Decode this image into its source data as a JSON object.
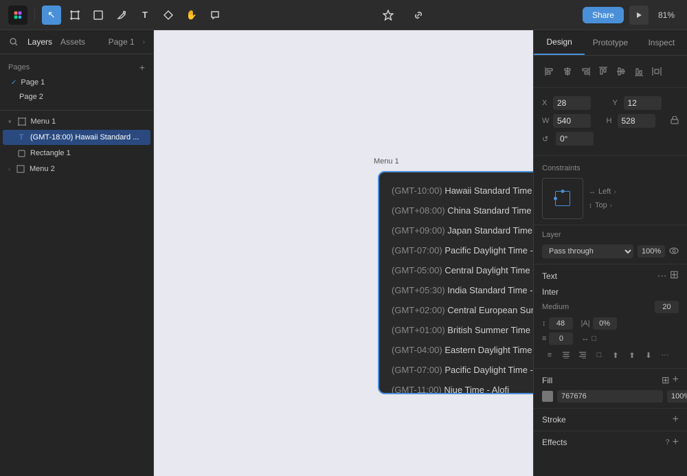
{
  "toolbar": {
    "logo_icon": "⬛",
    "tools": [
      {
        "name": "select",
        "icon": "↖",
        "active": true
      },
      {
        "name": "frame",
        "icon": "⊞",
        "active": false
      },
      {
        "name": "rectangle",
        "icon": "□",
        "active": false
      },
      {
        "name": "pen",
        "icon": "✒",
        "active": false
      },
      {
        "name": "text",
        "icon": "T",
        "active": false
      },
      {
        "name": "components",
        "icon": "⊕",
        "active": false
      },
      {
        "name": "hand",
        "icon": "✋",
        "active": false
      },
      {
        "name": "comment",
        "icon": "💬",
        "active": false
      }
    ],
    "center_tools": [
      {
        "name": "plugin",
        "icon": "✦"
      },
      {
        "name": "link",
        "icon": "🔗"
      }
    ],
    "share_label": "Share",
    "play_icon": "▶",
    "zoom": "81%"
  },
  "left_panel": {
    "tab_layers": "Layers",
    "tab_assets": "Assets",
    "page_selector": "Page 1",
    "pages_section": "Pages",
    "pages": [
      {
        "name": "Page 1",
        "active": true
      },
      {
        "name": "Page 2",
        "active": false
      }
    ],
    "layers": [
      {
        "id": "menu1",
        "name": "Menu 1",
        "type": "frame",
        "icon": "⊞",
        "indent": 0,
        "expanded": true
      },
      {
        "id": "text1",
        "name": "(GMT-18:00) Hawaii Standard ...",
        "type": "text",
        "icon": "T",
        "indent": 1,
        "selected": true
      },
      {
        "id": "rect1",
        "name": "Rectangle 1",
        "type": "rect",
        "icon": "□",
        "indent": 1,
        "selected": false
      },
      {
        "id": "menu2",
        "name": "Menu 2",
        "type": "frame",
        "icon": "⊞",
        "indent": 0,
        "expanded": false
      }
    ]
  },
  "canvas": {
    "frame_label": "Menu 1",
    "menu_items": [
      {
        "gmt": "(GMT-10:00)",
        "place": "Hawaii Standard Time - Honolulu"
      },
      {
        "gmt": "(GMT+08:00)",
        "place": "China Standard Time - Shanghai"
      },
      {
        "gmt": "(GMT+09:00)",
        "place": "Japan Standard Time - Tokyo"
      },
      {
        "gmt": "(GMT-07:00)",
        "place": "Pacific Daylight Time - San Francisco"
      },
      {
        "gmt": "(GMT-05:00)",
        "place": "Central Daylight Time - Chicago"
      },
      {
        "gmt": "(GMT+05:30)",
        "place": "India Standard Time - Kolkata"
      },
      {
        "gmt": "(GMT+02:00)",
        "place": "Central European Summer Time - Brussels"
      },
      {
        "gmt": "(GMT+01:00)",
        "place": "British Summer Time - London"
      },
      {
        "gmt": "(GMT-04:00)",
        "place": "Eastern Daylight Time - New York"
      },
      {
        "gmt": "(GMT-07:00)",
        "place": "Pacific Daylight Time - Los Angeles"
      },
      {
        "gmt": "(GMT-11:00)",
        "place": "Niue Time - Alofi"
      }
    ]
  },
  "right_panel": {
    "tabs": [
      "Design",
      "Prototype",
      "Inspect"
    ],
    "active_tab": "Design",
    "position": {
      "x_label": "X",
      "x_value": "28",
      "y_label": "Y",
      "y_value": "12",
      "w_label": "W",
      "w_value": "540",
      "h_label": "H",
      "h_value": "528",
      "r_label": "↺",
      "r_value": "0°"
    },
    "constraints": {
      "title": "Constraints",
      "h_constraint": "Left",
      "v_constraint": "Top"
    },
    "layer": {
      "title": "Layer",
      "blend_mode": "Pass through",
      "opacity": "100%"
    },
    "text": {
      "title": "Text",
      "font_name": "Inter",
      "font_weight": "Medium",
      "font_size": "20",
      "line_height": "48",
      "letter_spacing": "0%",
      "paragraph_spacing": "0",
      "align_options": [
        "←",
        "↔",
        "→",
        "□"
      ]
    },
    "fill": {
      "title": "Fill",
      "color": "#767676",
      "hex": "767676",
      "opacity": "100%"
    },
    "stroke": {
      "title": "Stroke"
    },
    "effects": {
      "title": "Effects"
    }
  }
}
